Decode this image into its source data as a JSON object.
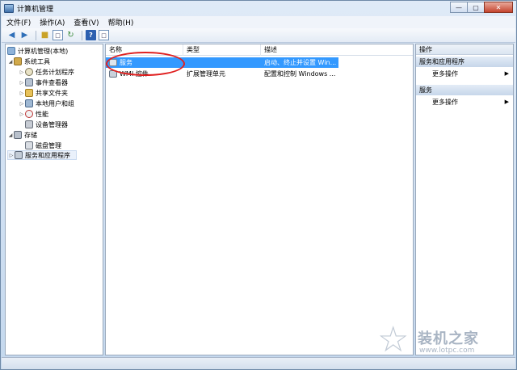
{
  "window": {
    "title": "计算机管理"
  },
  "window_buttons": [
    "—",
    "▢",
    "✕"
  ],
  "menu": [
    "文件(F)",
    "操作(A)",
    "查看(V)",
    "帮助(H)"
  ],
  "toolbar": {
    "help_label": "?"
  },
  "tree": {
    "root": "计算机管理(本地)",
    "system_tools": "系统工具",
    "task_scheduler": "任务计划程序",
    "event_viewer": "事件查看器",
    "shared_folders": "共享文件夹",
    "local_users": "本地用户和组",
    "performance": "性能",
    "device_manager": "设备管理器",
    "storage": "存储",
    "disk_management": "磁盘管理",
    "services_apps": "服务和应用程序"
  },
  "list": {
    "columns": [
      "名称",
      "类型",
      "描述"
    ],
    "rows": [
      {
        "name": "服务",
        "type": "",
        "desc": "启动、终止并设置 Win..."
      },
      {
        "name": "WMI 控件",
        "type": "扩展管理单元",
        "desc": "配置和控制 Windows ..."
      }
    ]
  },
  "actions": {
    "title": "操作",
    "section1": "服务和应用程序",
    "more1": "更多操作",
    "section2": "服务",
    "more2": "更多操作"
  },
  "watermark": {
    "text": "装机之家",
    "url": "www.lotpc.com"
  },
  "colors": {
    "selection": "#3399ff",
    "annotation": "#e02020"
  }
}
